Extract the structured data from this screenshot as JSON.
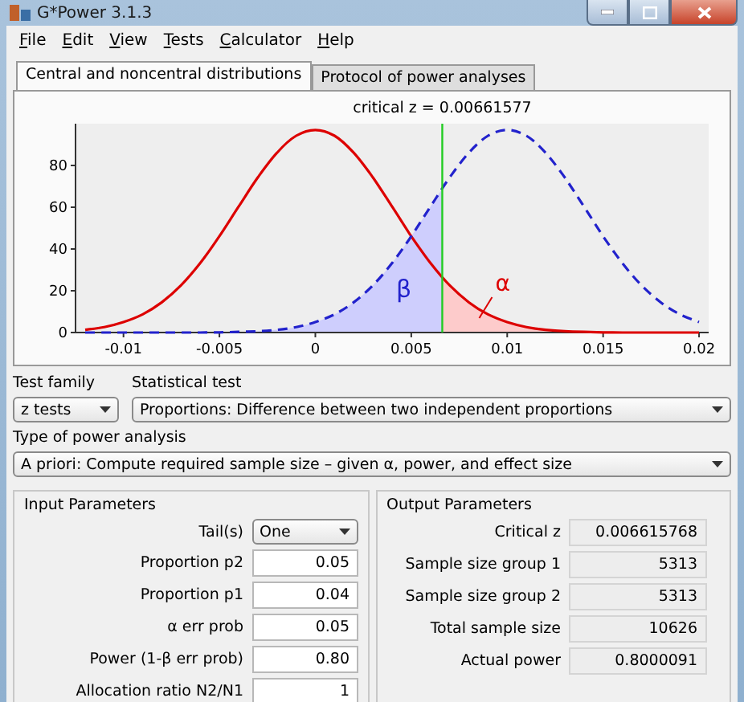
{
  "window": {
    "title": "G*Power 3.1.3"
  },
  "menu": [
    "File",
    "Edit",
    "View",
    "Tests",
    "Calculator",
    "Help"
  ],
  "tabs": [
    {
      "label": "Central and noncentral distributions",
      "selected": true
    },
    {
      "label": "Protocol of power analyses",
      "selected": false
    }
  ],
  "distribution_plot": {
    "chart_data": {
      "type": "line",
      "x": [
        -0.012,
        -0.011,
        -0.01,
        -0.009,
        -0.008,
        -0.007,
        -0.006,
        -0.005,
        -0.004,
        -0.003,
        -0.002,
        -0.001,
        0,
        0.001,
        0.002,
        0.003,
        0.004,
        0.005,
        0.006,
        0.007,
        0.008,
        0.009,
        0.01,
        0.011,
        0.012,
        0.013,
        0.014,
        0.015,
        0.016,
        0.017,
        0.018,
        0.019,
        0.02
      ],
      "title": "critical z = 0.00661577",
      "series": [
        {
          "color": "#dd0000",
          "line_style": "solid",
          "values": [
            1.3,
            2.6,
            5.0,
            8.7,
            14.5,
            22.6,
            33.2,
            46.1,
            60.3,
            74.2,
            86.1,
            94.2,
            97,
            94.2,
            86.1,
            74.2,
            60.3,
            46.1,
            33.2,
            22.6,
            14.5,
            8.7,
            5.0,
            2.6,
            1.3,
            0.6,
            0.3,
            0.1,
            0,
            0,
            0,
            0,
            0
          ]
        },
        {
          "color": "#2222cc",
          "line_style": "dashed",
          "values": [
            0,
            0,
            0,
            0,
            0,
            0,
            0,
            0.1,
            0.3,
            0.6,
            1.3,
            2.6,
            5.0,
            8.7,
            14.5,
            22.6,
            33.2,
            46.1,
            60.3,
            74.2,
            86.1,
            94.2,
            97,
            94.2,
            86.1,
            74.2,
            60.3,
            46.1,
            33.2,
            22.6,
            14.5,
            8.7,
            5.0
          ]
        }
      ],
      "xlim": [
        -0.0125,
        0.0205
      ],
      "ylim": [
        0,
        100
      ],
      "xticks": [
        {
          "value": -0.01,
          "label": "-0.01"
        },
        {
          "value": -0.005,
          "label": "-0.005"
        },
        {
          "value": 0,
          "label": "0"
        },
        {
          "value": 0.005,
          "label": "0.005"
        },
        {
          "value": 0.01,
          "label": "0.01"
        },
        {
          "value": 0.015,
          "label": "0.015"
        },
        {
          "value": 0.02,
          "label": "0.02"
        }
      ],
      "yticks": [
        {
          "value": 0,
          "label": "0"
        },
        {
          "value": 20,
          "label": "20"
        },
        {
          "value": 40,
          "label": "40"
        },
        {
          "value": 60,
          "label": "60"
        },
        {
          "value": 80,
          "label": "80"
        }
      ],
      "ref_lines": [
        {
          "axis": "x",
          "value": 0.00661577,
          "color": "#22cc22"
        }
      ],
      "annotations": [
        "β",
        "α"
      ]
    }
  },
  "test_family": {
    "label": "Test family",
    "value": "z tests"
  },
  "statistical_test": {
    "label": "Statistical test",
    "value": "Proportions: Difference between two independent proportions"
  },
  "type_of_power_analysis": {
    "label": "Type of power analysis",
    "value": "A priori: Compute required sample size – given α, power, and effect size"
  },
  "input_parameters": {
    "title": "Input Parameters",
    "rows": [
      {
        "kind": "dropdown",
        "label": "Tail(s)",
        "value": "One"
      },
      {
        "kind": "field",
        "label": "Proportion p2",
        "value": "0.05"
      },
      {
        "kind": "field",
        "label": "Proportion p1",
        "value": "0.04"
      },
      {
        "kind": "field",
        "label": "α err prob",
        "value": "0.05"
      },
      {
        "kind": "field",
        "label": "Power (1-β err prob)",
        "value": "0.80"
      },
      {
        "kind": "field",
        "label": "Allocation ratio N2/N1",
        "value": "1"
      }
    ]
  },
  "output_parameters": {
    "title": "Output Parameters",
    "rows": [
      {
        "label": "Critical z",
        "value": "0.006615768"
      },
      {
        "label": "Sample size group 1",
        "value": "5313"
      },
      {
        "label": "Sample size group 2",
        "value": "5313"
      },
      {
        "label": "Total sample size",
        "value": "10626"
      },
      {
        "label": "Actual power",
        "value": "0.8000091"
      }
    ]
  }
}
